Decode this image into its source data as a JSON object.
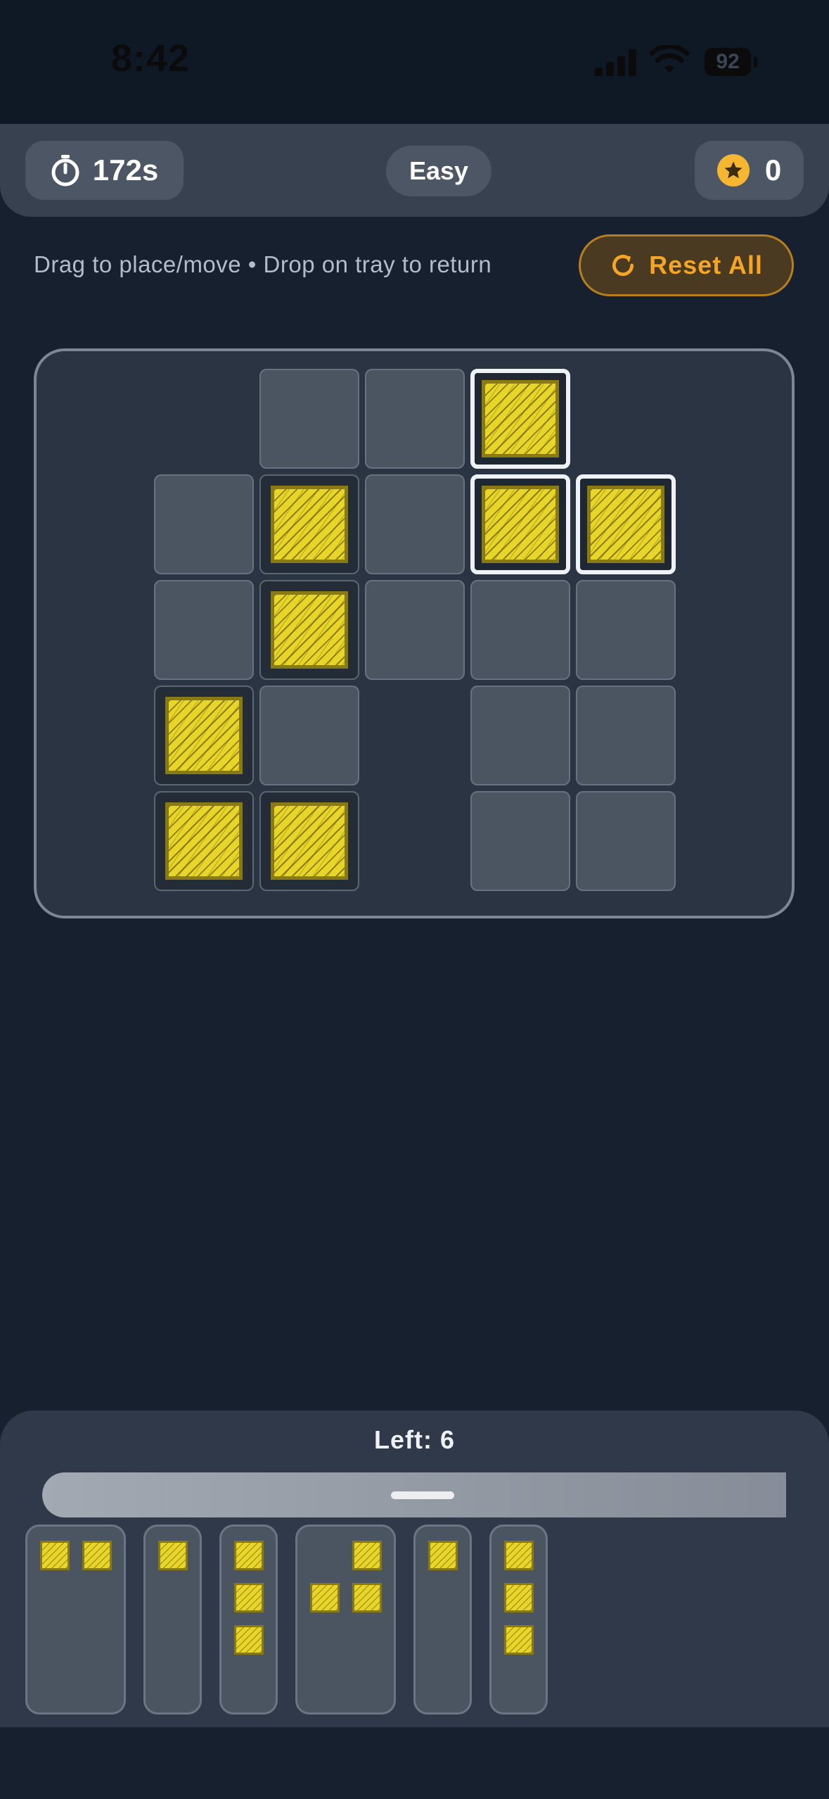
{
  "status_bar": {
    "time": "8:42",
    "battery": "92"
  },
  "header": {
    "timer": "172s",
    "difficulty": "Easy",
    "score": "0"
  },
  "hint": "Drag to place/move • Drop on tray to return",
  "reset_label": "Reset All",
  "tray": {
    "left_label": "Left: 6",
    "piece_count": 6
  },
  "colors": {
    "background": "#16202f",
    "block_yellow": "#e7d52a",
    "reset_accent": "#f5a524",
    "star": "#f5b731"
  },
  "icons": {
    "timer": "stopwatch-icon",
    "score": "star-icon",
    "reset": "refresh-icon",
    "signal": "cellular-signal-icon",
    "wifi": "wifi-icon",
    "battery": "battery-icon"
  }
}
